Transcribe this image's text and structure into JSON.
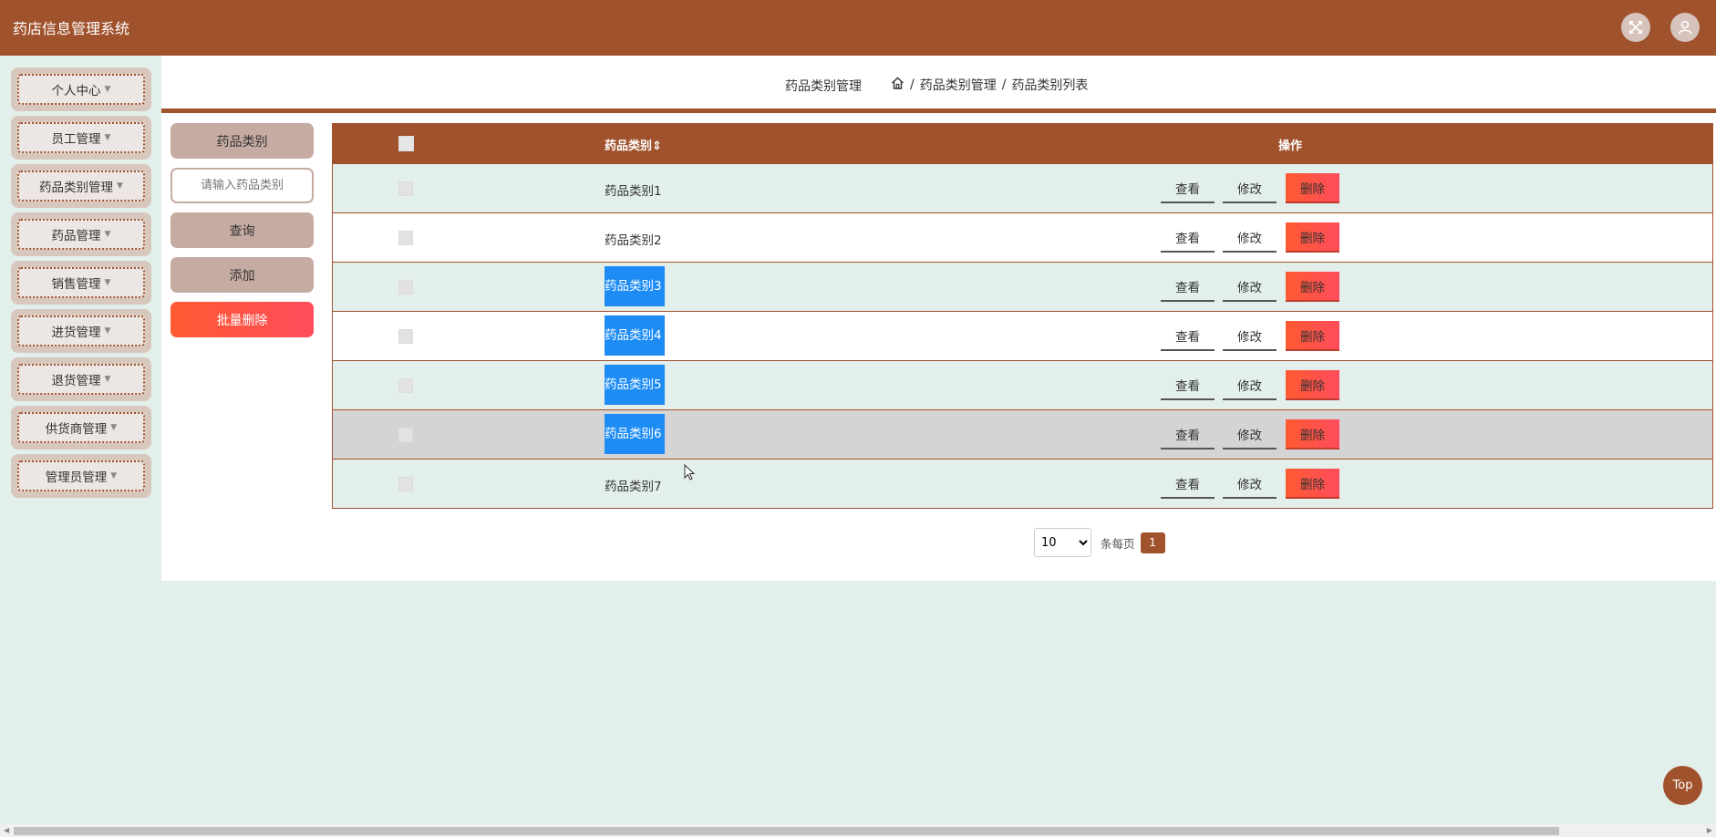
{
  "app": {
    "title": "药店信息管理系统"
  },
  "topbar_icons": [
    "fullscreen-icon",
    "user-avatar-icon"
  ],
  "sidebar": {
    "items": [
      {
        "label": "个人中心"
      },
      {
        "label": "员工管理"
      },
      {
        "label": "药品类别管理"
      },
      {
        "label": "药品管理"
      },
      {
        "label": "销售管理"
      },
      {
        "label": "进货管理"
      },
      {
        "label": "退货管理"
      },
      {
        "label": "供货商管理"
      },
      {
        "label": "管理员管理"
      }
    ]
  },
  "header": {
    "page_title": "药品类别管理",
    "breadcrumb_sep": "/",
    "breadcrumb_1": "药品类别管理",
    "breadcrumb_2": "药品类别列表"
  },
  "controls": {
    "field_label": "药品类别",
    "search_placeholder": "请输入药品类别",
    "search_value": "",
    "query_label": "查询",
    "add_label": "添加",
    "batch_delete_label": "批量删除"
  },
  "table": {
    "col_name": "药品类别",
    "sort_icon": "⇕",
    "col_ops": "操作",
    "view_label": "查看",
    "edit_label": "修改",
    "delete_label": "删除",
    "rows": [
      {
        "name": "药品类别1"
      },
      {
        "name": "药品类别2"
      },
      {
        "name": "药品类别3"
      },
      {
        "name": "药品类别4"
      },
      {
        "name": "药品类别5"
      },
      {
        "name": "药品类别6"
      },
      {
        "name": "药品类别7"
      }
    ]
  },
  "pagination": {
    "page_size": "10",
    "page_size_options": [
      "10"
    ],
    "per_page_label": "条每页",
    "current_page": "1"
  },
  "totop": {
    "label": "Top"
  },
  "colors": {
    "brand": "#a0522d",
    "selection": "#1e8cf5",
    "danger": "#ff5a31"
  }
}
